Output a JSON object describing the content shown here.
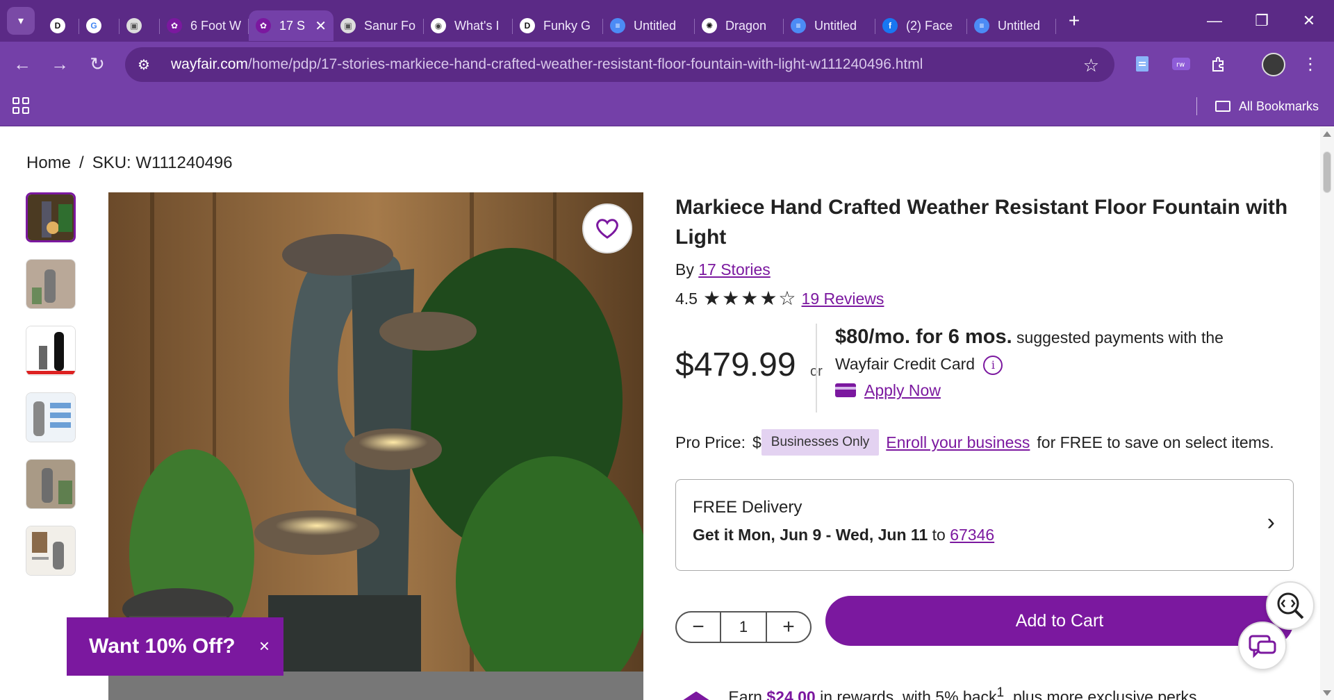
{
  "tabs": [
    {
      "title": "",
      "icon": "d-logo-icon"
    },
    {
      "title": "",
      "icon": "google-icon"
    },
    {
      "title": "",
      "icon": "image-icon"
    },
    {
      "title": "6 Foot W",
      "icon": "wayfair-icon"
    },
    {
      "title": "17 S",
      "icon": "wayfair-icon",
      "active": true
    },
    {
      "title": "Sanur Fo",
      "icon": "image-icon"
    },
    {
      "title": "What's I",
      "icon": "chrome-icon"
    },
    {
      "title": "Funky G",
      "icon": "d-logo-icon"
    },
    {
      "title": "Untitled",
      "icon": "docs-icon"
    },
    {
      "title": "Dragon",
      "icon": "openai-icon"
    },
    {
      "title": "Untitled",
      "icon": "docs-icon"
    },
    {
      "title": "(2) Face",
      "icon": "facebook-icon"
    },
    {
      "title": "Untitled",
      "icon": "docs-icon"
    }
  ],
  "address_bar": {
    "domain": "wayfair.com",
    "path": "/home/pdp/17-stories-markiece-hand-crafted-weather-resistant-floor-fountain-with-light-w111240496.html"
  },
  "bookmarks": {
    "all_label": "All Bookmarks"
  },
  "breadcrumb": {
    "home": "Home",
    "separator": "/",
    "sku": "SKU: W111240496"
  },
  "product": {
    "title": "Markiece Hand Crafted Weather Resistant Floor Fountain with Light",
    "by_prefix": "By",
    "brand": "17 Stories",
    "rating": "4.5",
    "rating_value": 4.5,
    "reviews": "19 Reviews",
    "price": "$479.99",
    "or_label": "or",
    "financing_bold": "$80/mo. for 6 mos.",
    "financing_text": "suggested payments with the Wayfair Credit Card",
    "apply_now": "Apply Now",
    "pro_label": "Pro Price:",
    "pro_dollar": "$",
    "pro_badge": "Businesses Only",
    "enroll_link": "Enroll your business",
    "enroll_suffix": "for FREE to save on select items.",
    "delivery_title": "FREE Delivery",
    "delivery_prefix": "Get it",
    "delivery_dates": "Mon, Jun 9 - Wed, Jun 11",
    "delivery_to": "to",
    "zip": "67346",
    "quantity": "1",
    "add_to_cart": "Add to Cart",
    "rewards_prefix": "Earn",
    "rewards_amount": "$24.00",
    "rewards_suffix": "in rewards, with 5% back",
    "rewards_sup": "1",
    "rewards_tail": ", plus more exclusive perks"
  },
  "promo": {
    "text": "Want 10% Off?",
    "close": "×"
  },
  "colors": {
    "brand_purple": "#7b189f",
    "chrome_dark": "#5b2a86",
    "chrome_light": "#7440a8"
  }
}
